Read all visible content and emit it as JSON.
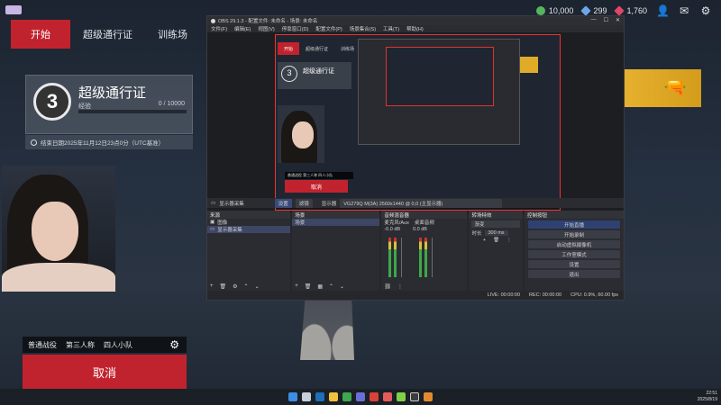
{
  "game": {
    "tabs": [
      {
        "label": "开始",
        "active": true
      },
      {
        "label": "超级通行证",
        "active": false
      },
      {
        "label": "训练场",
        "active": false
      }
    ],
    "currencies": [
      {
        "icon": "coin-icon",
        "value": "10,000",
        "color": "#55b65a"
      },
      {
        "icon": "diamond-icon",
        "value": "299",
        "color": "#6fa7e6"
      },
      {
        "icon": "gem-icon",
        "value": "1,760",
        "color": "#e04668"
      }
    ],
    "pass": {
      "level": "3",
      "title": "超级通行证",
      "exp_label": "经验",
      "progress_text": "0 / 10000",
      "progress": 0,
      "end_date": "结束日期2025年11月12日23点0分（UTC基准）"
    },
    "mode": {
      "items": [
        "普通战役",
        "第三人称",
        "四人小队"
      ]
    },
    "cancel_label": "取消",
    "accent": "#c1232e"
  },
  "obs": {
    "title": "OBS 29.1.3 - 配置文件: 未命名 - 场景: 未命名",
    "menu": [
      "文件(F)",
      "编辑(E)",
      "视图(V)",
      "停靠窗口(D)",
      "配置文件(P)",
      "场景集合(S)",
      "工具(T)",
      "帮助(H)"
    ],
    "source_bar": {
      "name": "显示器采集",
      "props": "设置",
      "filters": "滤镜",
      "display_label": "显示器",
      "display_value": "VG279Q M(3A) 2560x1440 @ 0,0 (主显示器)"
    },
    "docks": {
      "sources_title": "来源",
      "sources": [
        "图像",
        "显示器采集"
      ],
      "scenes_title": "场景",
      "scenes": [
        "场景"
      ],
      "mixer_title": "音频混音器",
      "mixer_channels": [
        {
          "name": "麦克风/Aux",
          "db": "-0.0 dB"
        },
        {
          "name": "桌面音频",
          "db": "0.0 dB"
        }
      ],
      "transitions_title": "转场特效",
      "transition_type": "渐变",
      "duration_label": "时长",
      "duration_value": "300 ms",
      "controls_title": "控制按钮",
      "controls": [
        "开始直播",
        "开始录制",
        "启动虚拟摄像机",
        "工作室模式",
        "设置",
        "退出"
      ]
    },
    "status": {
      "live": "LIVE: 00:00:00",
      "rec": "REC: 00:00:00",
      "cpu": "CPU: 0.9%, 60.00 fps"
    }
  },
  "taskbar": {
    "time": "22:51",
    "date": "2025/8/19"
  }
}
